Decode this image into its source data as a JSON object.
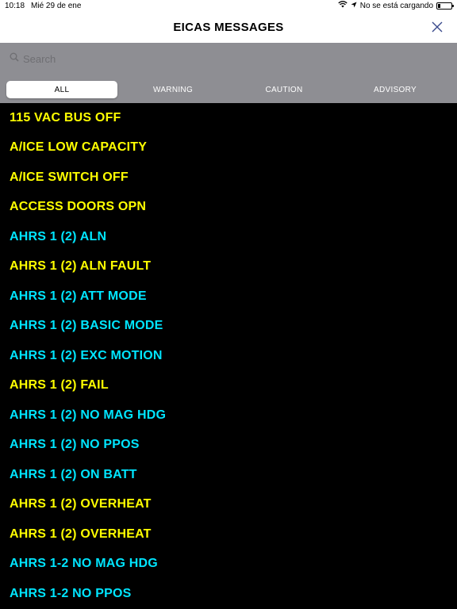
{
  "status_bar": {
    "time": "10:18",
    "date": "Mié 29 de ene",
    "charging_status": "No se está cargando",
    "battery_level": 0.18
  },
  "header": {
    "title": "EICAS MESSAGES"
  },
  "search": {
    "placeholder": "Search"
  },
  "tabs": [
    {
      "label": "ALL",
      "selected": true
    },
    {
      "label": "WARNING",
      "selected": false
    },
    {
      "label": "CAUTION",
      "selected": false
    },
    {
      "label": "ADVISORY",
      "selected": false
    }
  ],
  "colors": {
    "caution": "#ffff00",
    "advisory": "#00e5ff",
    "list_background": "#000000",
    "search_background": "#8e8e93"
  },
  "messages": [
    {
      "text": "115 VAC BUS OFF",
      "level": "caution"
    },
    {
      "text": "A/ICE LOW CAPACITY",
      "level": "caution"
    },
    {
      "text": "A/ICE SWITCH OFF",
      "level": "caution"
    },
    {
      "text": "ACCESS DOORS OPN",
      "level": "caution"
    },
    {
      "text": "AHRS 1 (2) ALN",
      "level": "advisory"
    },
    {
      "text": "AHRS 1 (2) ALN FAULT",
      "level": "caution"
    },
    {
      "text": "AHRS 1 (2) ATT MODE",
      "level": "advisory"
    },
    {
      "text": "AHRS 1 (2) BASIC MODE",
      "level": "advisory"
    },
    {
      "text": "AHRS 1 (2) EXC MOTION",
      "level": "advisory"
    },
    {
      "text": "AHRS 1 (2) FAIL",
      "level": "caution"
    },
    {
      "text": "AHRS 1 (2) NO MAG HDG",
      "level": "advisory"
    },
    {
      "text": "AHRS 1 (2) NO PPOS",
      "level": "advisory"
    },
    {
      "text": "AHRS 1 (2) ON BATT",
      "level": "advisory"
    },
    {
      "text": "AHRS 1 (2) OVERHEAT",
      "level": "caution"
    },
    {
      "text": "AHRS 1 (2) OVERHEAT",
      "level": "caution"
    },
    {
      "text": "AHRS 1-2 NO MAG HDG",
      "level": "advisory"
    },
    {
      "text": "AHRS 1-2 NO PPOS",
      "level": "advisory"
    }
  ]
}
